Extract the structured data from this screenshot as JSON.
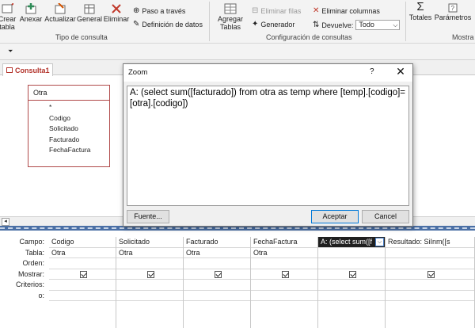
{
  "ribbon": {
    "buttons": {
      "crear_tabla": "Crear\ntabla",
      "anexar": "Anexar",
      "actualizar": "Actualizar",
      "general": "General",
      "eliminar": "Eliminar",
      "agregar_tablas": "Agregar\nTablas",
      "totales": "Totales",
      "parametros": "Parámetros"
    },
    "small": {
      "paso_a_traves": "Paso a través",
      "definicion_datos": "Definición de datos",
      "eliminar_filas": "Eliminar filas",
      "generador": "Generador",
      "eliminar_columnas": "Eliminar columnas",
      "devuelve_label": "Devuelve:",
      "devuelve_value": "Todo"
    },
    "groups": {
      "tipo_consulta": "Tipo de consulta",
      "configuracion": "Configuración de consultas",
      "mostrar": "Mostra"
    }
  },
  "document": {
    "tab_label": "Consulta1",
    "table": {
      "name": "Otra",
      "fields": [
        "*",
        "Codigo",
        "Solicitado",
        "Facturado",
        "FechaFactura"
      ]
    }
  },
  "grid": {
    "row_labels": [
      "Campo:",
      "Tabla:",
      "Orden:",
      "Mostrar:",
      "Criterios:",
      "o:"
    ],
    "columns": [
      {
        "campo": "Codigo",
        "tabla": "Otra",
        "mostrar": true
      },
      {
        "campo": "Solicitado",
        "tabla": "Otra",
        "mostrar": true
      },
      {
        "campo": "Facturado",
        "tabla": "Otra",
        "mostrar": true
      },
      {
        "campo": "FechaFactura",
        "tabla": "Otra",
        "mostrar": true
      },
      {
        "campo": "A: (select sum([f",
        "tabla": "",
        "mostrar": true,
        "selected": true
      },
      {
        "campo": "Resultado: SiInm([s",
        "tabla": "",
        "mostrar": true
      }
    ]
  },
  "dialog": {
    "title": "Zoom",
    "help": "?",
    "close": "✕",
    "text": "A: (select sum([facturado]) from otra as temp where [temp].[codigo]=[otra].[codigo])",
    "font_button": "Fuente...",
    "ok_button": "Aceptar",
    "cancel_button": "Cancel"
  },
  "colors": {
    "accent": "#4a6fa5",
    "tab_text": "#b3342c",
    "table_border": "#b04a4a"
  }
}
